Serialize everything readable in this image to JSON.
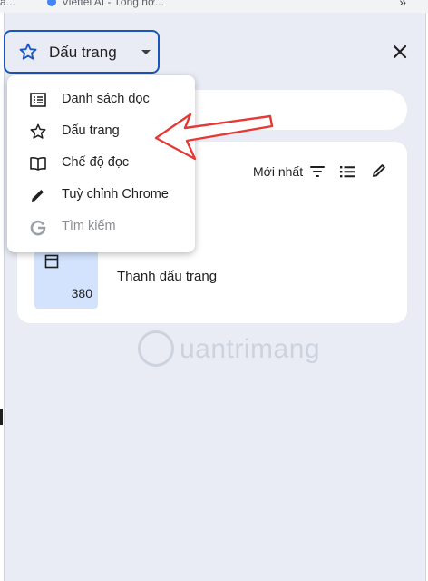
{
  "browser": {
    "tab_fragments": [
      "a...",
      "Viettel AI - Tổng hợ..."
    ],
    "overflow_icon": "chevron-double-right-icon"
  },
  "panel": {
    "selector_label": "Dấu trang",
    "close_icon": "close-icon",
    "sort_label": "Mới nhất",
    "partial_text": "i",
    "folder": {
      "title": "Thanh dấu trang",
      "count": "380"
    }
  },
  "menu": {
    "items": [
      {
        "label": "Danh sách đọc",
        "icon": "reading-list-icon",
        "enabled": true
      },
      {
        "label": "Dấu trang",
        "icon": "star-icon",
        "enabled": true
      },
      {
        "label": "Chế độ đọc",
        "icon": "reading-mode-icon",
        "enabled": true
      },
      {
        "label": "Tuỳ chỉnh Chrome",
        "icon": "edit-pen-icon",
        "enabled": true
      },
      {
        "label": "Tìm kiếm",
        "icon": "google-g-icon",
        "enabled": false
      }
    ]
  },
  "watermark": {
    "text": "uantrimang"
  },
  "colors": {
    "accent": "#1a56b8",
    "panel_bg": "#e9ecf5",
    "folder_bg": "#d3e3fd",
    "arrow": "#e53935"
  }
}
